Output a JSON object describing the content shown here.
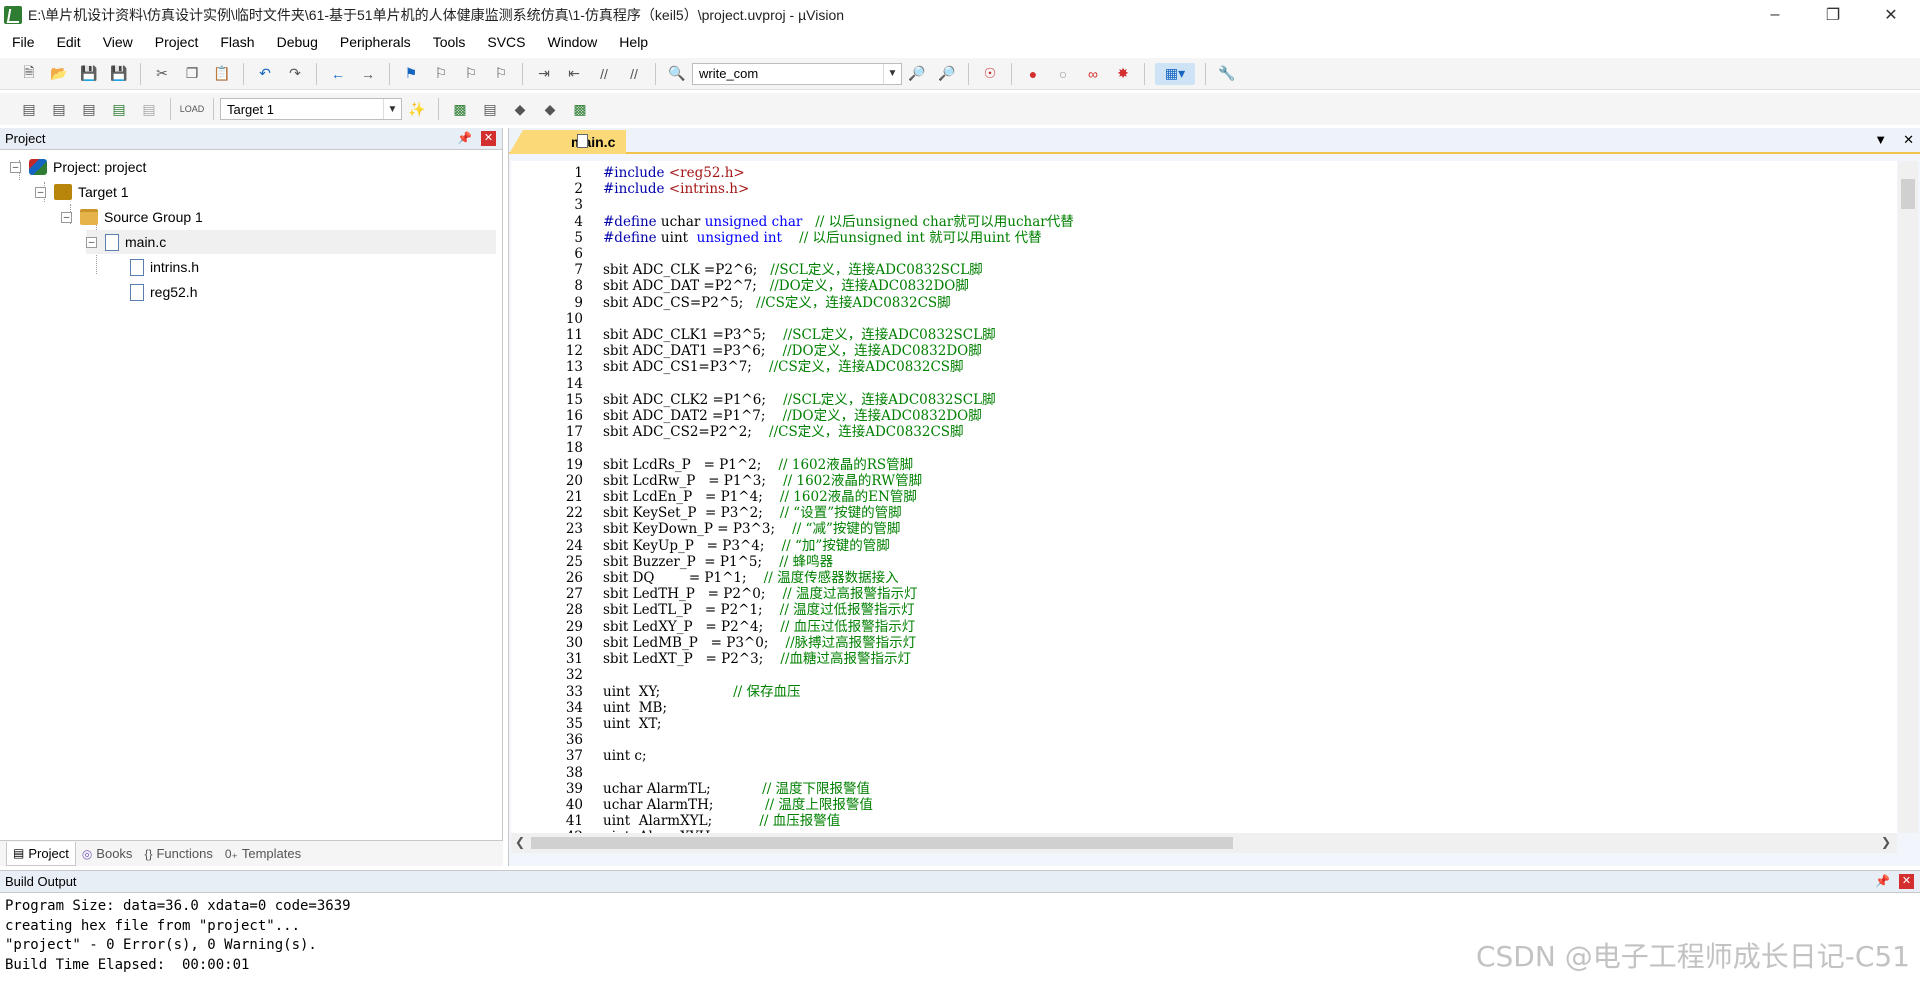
{
  "window": {
    "title": "E:\\单片机设计资料\\仿真设计实例\\临时文件夹\\61-基于51单片机的人体健康监测系统仿真\\1-仿真程序（keil5）\\project.uvproj - µVision"
  },
  "menu": [
    "File",
    "Edit",
    "View",
    "Project",
    "Flash",
    "Debug",
    "Peripherals",
    "Tools",
    "SVCS",
    "Window",
    "Help"
  ],
  "toolbar": {
    "find_combo_value": "write_com",
    "target_combo_value": "Target 1"
  },
  "project_panel": {
    "title": "Project",
    "tree": {
      "root": "Project: project",
      "target": "Target 1",
      "group": "Source Group 1",
      "file": "main.c",
      "includes": [
        "intrins.h",
        "reg52.h"
      ]
    },
    "tabs": [
      "Project",
      "Books",
      "Functions",
      "Templates"
    ]
  },
  "editor": {
    "active_tab": "main.c",
    "line_numbers": "1\n2\n3\n4\n5\n6\n7\n8\n9\n10\n11\n12\n13\n14\n15\n16\n17\n18\n19\n20\n21\n22\n23\n24\n25\n26\n27\n28\n29\n30\n31\n32\n33\n34\n35\n36\n37\n38\n39\n40\n41\n42",
    "lines": [
      "#include <reg52.h>",
      "#include <intrins.h>",
      "",
      "#define uchar unsigned char   // 以后unsigned char就可以用uchar代替",
      "#define uint  unsigned int    // 以后unsigned int 就可以用uint 代替",
      "",
      "sbit ADC_CLK =P2^6;   //SCL定义，连接ADC0832SCL脚",
      "sbit ADC_DAT =P2^7;   //DO定义，连接ADC0832DO脚",
      "sbit ADC_CS=P2^5;   //CS定义，连接ADC0832CS脚",
      "",
      "sbit ADC_CLK1 =P3^5;    //SCL定义，连接ADC0832SCL脚",
      "sbit ADC_DAT1 =P3^6;    //DO定义，连接ADC0832DO脚",
      "sbit ADC_CS1=P3^7;    //CS定义，连接ADC0832CS脚",
      "",
      "sbit ADC_CLK2 =P1^6;    //SCL定义，连接ADC0832SCL脚",
      "sbit ADC_DAT2 =P1^7;    //DO定义，连接ADC0832DO脚",
      "sbit ADC_CS2=P2^2;    //CS定义，连接ADC0832CS脚",
      "",
      "sbit LcdRs_P   = P1^2;    // 1602液晶的RS管脚",
      "sbit LcdRw_P   = P1^3;    // 1602液晶的RW管脚",
      "sbit LcdEn_P   = P1^4;    // 1602液晶的EN管脚",
      "sbit KeySet_P  = P3^2;    // “设置”按键的管脚",
      "sbit KeyDown_P = P3^3;    // “减”按键的管脚",
      "sbit KeyUp_P   = P3^4;    // “加”按键的管脚",
      "sbit Buzzer_P  = P1^5;    // 蜂鸣器",
      "sbit DQ        = P1^1;    // 温度传感器数据接入",
      "sbit LedTH_P   = P2^0;    // 温度过高报警指示灯",
      "sbit LedTL_P   = P2^1;    // 温度过低报警指示灯",
      "sbit LedXY_P   = P2^4;    // 血压过低报警指示灯",
      "sbit LedMB_P   = P3^0;    //脉搏过高报警指示灯",
      "sbit LedXT_P   = P2^3;    //血糖过高报警指示灯",
      "",
      "uint  XY;                 // 保存血压",
      "uint  MB;",
      "uint  XT;",
      "",
      "uint c;",
      "",
      "uchar AlarmTL;            // 温度下限报警值",
      "uchar AlarmTH;            // 温度上限报警值",
      "uint  AlarmXYL;           // 血压报警值",
      "uint  AlarmXYH;"
    ]
  },
  "build_output": {
    "title": "Build Output",
    "text": "Program Size: data=36.0 xdata=0 code=3639\ncreating hex file from \"project\"...\n\"project\" - 0 Error(s), 0 Warning(s).\nBuild Time Elapsed:  00:00:01"
  },
  "watermark": "CSDN @电子工程师成长日记-C51"
}
